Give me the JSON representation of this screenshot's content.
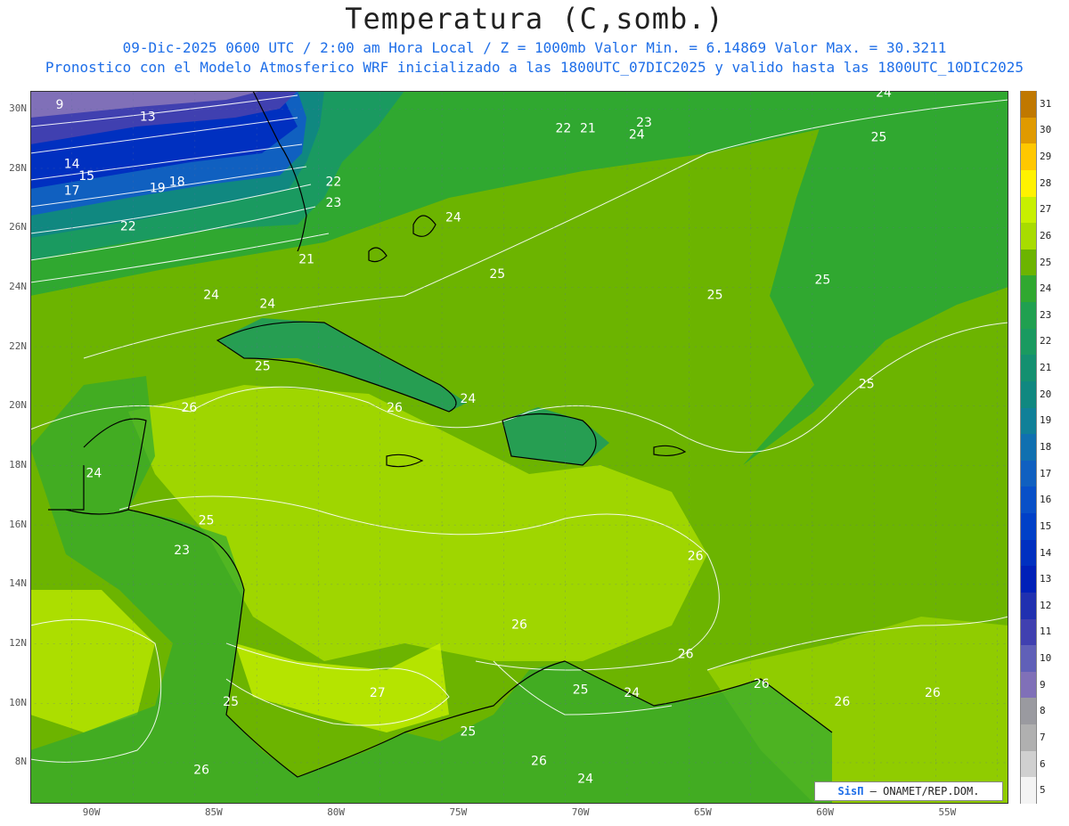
{
  "title": "Temperatura (C,somb.)",
  "subtitle1": "09-Dic-2025  0600 UTC / 2:00 am Hora Local / Z = 1000mb   Valor Min. = 6.14869  Valor Max. = 30.3211",
  "subtitle2": "Pronostico con el Modelo Atmosferico WRF inicializado a las 1800UTC_07DIC2025 y valido hasta las  1800UTC_10DIC2025",
  "credit": {
    "brand": "SisΠ",
    "text": " – ONAMET/REP.DOM."
  },
  "lat_labels": [
    "30N",
    "28N",
    "26N",
    "24N",
    "22N",
    "20N",
    "18N",
    "16N",
    "14N",
    "12N",
    "10N",
    "8N"
  ],
  "lon_labels": [
    "90W",
    "85W",
    "80W",
    "75W",
    "70W",
    "65W",
    "60W",
    "55W"
  ],
  "colorbar": {
    "labels": [
      "31",
      "30",
      "29",
      "28",
      "27",
      "26",
      "25",
      "24",
      "23",
      "22",
      "21",
      "20",
      "19",
      "18",
      "17",
      "16",
      "15",
      "14",
      "13",
      "12",
      "11",
      "10",
      "9",
      "8",
      "7",
      "6",
      "5"
    ],
    "colors": [
      "#c07800",
      "#e09a00",
      "#ffc800",
      "#fff200",
      "#c8f000",
      "#a8dc00",
      "#6cb400",
      "#30a830",
      "#20a050",
      "#1a9a60",
      "#149070",
      "#108880",
      "#108098",
      "#1070b0",
      "#1060c0",
      "#0850c8",
      "#0040c8",
      "#0030c0",
      "#0020b8",
      "#2030b0",
      "#4040b0",
      "#6060b8",
      "#8070b8",
      "#9a9aa0",
      "#b0b0b0",
      "#d0d0d0",
      "#f4f4f4"
    ]
  },
  "map_labels": [
    {
      "text": "9",
      "lon": -91.3,
      "lat": 30.0
    },
    {
      "text": "13",
      "lon": -87.7,
      "lat": 29.6
    },
    {
      "text": "14",
      "lon": -90.8,
      "lat": 28.0
    },
    {
      "text": "15",
      "lon": -90.2,
      "lat": 27.6
    },
    {
      "text": "17",
      "lon": -90.8,
      "lat": 27.1
    },
    {
      "text": "19",
      "lon": -87.3,
      "lat": 27.2
    },
    {
      "text": "18",
      "lon": -86.5,
      "lat": 27.4
    },
    {
      "text": "22",
      "lon": -88.5,
      "lat": 25.9
    },
    {
      "text": "21",
      "lon": -81.2,
      "lat": 24.8
    },
    {
      "text": "22",
      "lon": -80.1,
      "lat": 27.4
    },
    {
      "text": "23",
      "lon": -80.1,
      "lat": 26.7
    },
    {
      "text": "24",
      "lon": -75.2,
      "lat": 26.2
    },
    {
      "text": "22",
      "lon": -70.7,
      "lat": 29.2
    },
    {
      "text": "21",
      "lon": -69.7,
      "lat": 29.2
    },
    {
      "text": "23",
      "lon": -67.4,
      "lat": 29.4
    },
    {
      "text": "24",
      "lon": -67.7,
      "lat": 29.0
    },
    {
      "text": "24",
      "lon": -57.6,
      "lat": 30.4
    },
    {
      "text": "25",
      "lon": -57.8,
      "lat": 28.9
    },
    {
      "text": "25",
      "lon": -73.4,
      "lat": 24.3
    },
    {
      "text": "25",
      "lon": -64.5,
      "lat": 23.6
    },
    {
      "text": "25",
      "lon": -60.1,
      "lat": 24.1
    },
    {
      "text": "24",
      "lon": -85.1,
      "lat": 23.6
    },
    {
      "text": "24",
      "lon": -82.8,
      "lat": 23.3
    },
    {
      "text": "25",
      "lon": -83.0,
      "lat": 21.2
    },
    {
      "text": "25",
      "lon": -58.3,
      "lat": 20.6
    },
    {
      "text": "26",
      "lon": -86.0,
      "lat": 19.8
    },
    {
      "text": "26",
      "lon": -77.6,
      "lat": 19.8
    },
    {
      "text": "24",
      "lon": -74.6,
      "lat": 20.1
    },
    {
      "text": "24",
      "lon": -89.9,
      "lat": 17.6
    },
    {
      "text": "25",
      "lon": -85.3,
      "lat": 16.0
    },
    {
      "text": "23",
      "lon": -86.3,
      "lat": 15.0
    },
    {
      "text": "26",
      "lon": -65.3,
      "lat": 14.8
    },
    {
      "text": "26",
      "lon": -72.5,
      "lat": 12.5
    },
    {
      "text": "26",
      "lon": -65.7,
      "lat": 11.5
    },
    {
      "text": "27",
      "lon": -78.3,
      "lat": 10.2
    },
    {
      "text": "25",
      "lon": -84.3,
      "lat": 9.9
    },
    {
      "text": "25",
      "lon": -70.0,
      "lat": 10.3
    },
    {
      "text": "24",
      "lon": -67.9,
      "lat": 10.2
    },
    {
      "text": "26",
      "lon": -62.6,
      "lat": 10.5
    },
    {
      "text": "26",
      "lon": -59.3,
      "lat": 9.9
    },
    {
      "text": "26",
      "lon": -55.6,
      "lat": 10.2
    },
    {
      "text": "25",
      "lon": -74.6,
      "lat": 8.9
    },
    {
      "text": "26",
      "lon": -71.7,
      "lat": 7.9
    },
    {
      "text": "26",
      "lon": -85.5,
      "lat": 7.6
    },
    {
      "text": "24",
      "lon": -69.8,
      "lat": 7.3
    }
  ]
}
